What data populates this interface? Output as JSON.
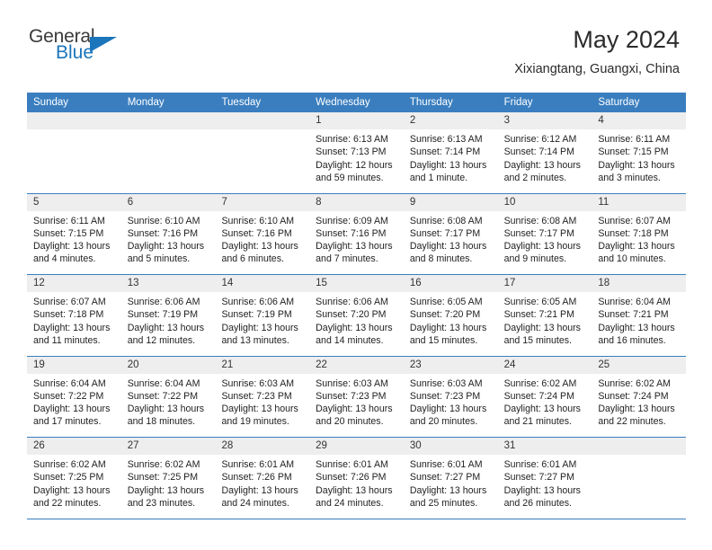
{
  "brand": {
    "name_top": "General",
    "name_bottom": "Blue",
    "accent_color": "#1b75bb"
  },
  "header": {
    "title": "May 2024",
    "subtitle": "Xixiangtang, Guangxi, China"
  },
  "calendar": {
    "header_bg": "#3a7ebf",
    "daynum_band_bg": "#eeeeee",
    "weekday_labels": [
      "Sunday",
      "Monday",
      "Tuesday",
      "Wednesday",
      "Thursday",
      "Friday",
      "Saturday"
    ],
    "weeks": [
      [
        {
          "empty": true,
          "day": ""
        },
        {
          "empty": true,
          "day": ""
        },
        {
          "empty": true,
          "day": ""
        },
        {
          "day": "1",
          "sunrise": "Sunrise: 6:13 AM",
          "sunset": "Sunset: 7:13 PM",
          "daylight1": "Daylight: 12 hours",
          "daylight2": "and 59 minutes."
        },
        {
          "day": "2",
          "sunrise": "Sunrise: 6:13 AM",
          "sunset": "Sunset: 7:14 PM",
          "daylight1": "Daylight: 13 hours",
          "daylight2": "and 1 minute."
        },
        {
          "day": "3",
          "sunrise": "Sunrise: 6:12 AM",
          "sunset": "Sunset: 7:14 PM",
          "daylight1": "Daylight: 13 hours",
          "daylight2": "and 2 minutes."
        },
        {
          "day": "4",
          "sunrise": "Sunrise: 6:11 AM",
          "sunset": "Sunset: 7:15 PM",
          "daylight1": "Daylight: 13 hours",
          "daylight2": "and 3 minutes."
        }
      ],
      [
        {
          "day": "5",
          "sunrise": "Sunrise: 6:11 AM",
          "sunset": "Sunset: 7:15 PM",
          "daylight1": "Daylight: 13 hours",
          "daylight2": "and 4 minutes."
        },
        {
          "day": "6",
          "sunrise": "Sunrise: 6:10 AM",
          "sunset": "Sunset: 7:16 PM",
          "daylight1": "Daylight: 13 hours",
          "daylight2": "and 5 minutes."
        },
        {
          "day": "7",
          "sunrise": "Sunrise: 6:10 AM",
          "sunset": "Sunset: 7:16 PM",
          "daylight1": "Daylight: 13 hours",
          "daylight2": "and 6 minutes."
        },
        {
          "day": "8",
          "sunrise": "Sunrise: 6:09 AM",
          "sunset": "Sunset: 7:16 PM",
          "daylight1": "Daylight: 13 hours",
          "daylight2": "and 7 minutes."
        },
        {
          "day": "9",
          "sunrise": "Sunrise: 6:08 AM",
          "sunset": "Sunset: 7:17 PM",
          "daylight1": "Daylight: 13 hours",
          "daylight2": "and 8 minutes."
        },
        {
          "day": "10",
          "sunrise": "Sunrise: 6:08 AM",
          "sunset": "Sunset: 7:17 PM",
          "daylight1": "Daylight: 13 hours",
          "daylight2": "and 9 minutes."
        },
        {
          "day": "11",
          "sunrise": "Sunrise: 6:07 AM",
          "sunset": "Sunset: 7:18 PM",
          "daylight1": "Daylight: 13 hours",
          "daylight2": "and 10 minutes."
        }
      ],
      [
        {
          "day": "12",
          "sunrise": "Sunrise: 6:07 AM",
          "sunset": "Sunset: 7:18 PM",
          "daylight1": "Daylight: 13 hours",
          "daylight2": "and 11 minutes."
        },
        {
          "day": "13",
          "sunrise": "Sunrise: 6:06 AM",
          "sunset": "Sunset: 7:19 PM",
          "daylight1": "Daylight: 13 hours",
          "daylight2": "and 12 minutes."
        },
        {
          "day": "14",
          "sunrise": "Sunrise: 6:06 AM",
          "sunset": "Sunset: 7:19 PM",
          "daylight1": "Daylight: 13 hours",
          "daylight2": "and 13 minutes."
        },
        {
          "day": "15",
          "sunrise": "Sunrise: 6:06 AM",
          "sunset": "Sunset: 7:20 PM",
          "daylight1": "Daylight: 13 hours",
          "daylight2": "and 14 minutes."
        },
        {
          "day": "16",
          "sunrise": "Sunrise: 6:05 AM",
          "sunset": "Sunset: 7:20 PM",
          "daylight1": "Daylight: 13 hours",
          "daylight2": "and 15 minutes."
        },
        {
          "day": "17",
          "sunrise": "Sunrise: 6:05 AM",
          "sunset": "Sunset: 7:21 PM",
          "daylight1": "Daylight: 13 hours",
          "daylight2": "and 15 minutes."
        },
        {
          "day": "18",
          "sunrise": "Sunrise: 6:04 AM",
          "sunset": "Sunset: 7:21 PM",
          "daylight1": "Daylight: 13 hours",
          "daylight2": "and 16 minutes."
        }
      ],
      [
        {
          "day": "19",
          "sunrise": "Sunrise: 6:04 AM",
          "sunset": "Sunset: 7:22 PM",
          "daylight1": "Daylight: 13 hours",
          "daylight2": "and 17 minutes."
        },
        {
          "day": "20",
          "sunrise": "Sunrise: 6:04 AM",
          "sunset": "Sunset: 7:22 PM",
          "daylight1": "Daylight: 13 hours",
          "daylight2": "and 18 minutes."
        },
        {
          "day": "21",
          "sunrise": "Sunrise: 6:03 AM",
          "sunset": "Sunset: 7:23 PM",
          "daylight1": "Daylight: 13 hours",
          "daylight2": "and 19 minutes."
        },
        {
          "day": "22",
          "sunrise": "Sunrise: 6:03 AM",
          "sunset": "Sunset: 7:23 PM",
          "daylight1": "Daylight: 13 hours",
          "daylight2": "and 20 minutes."
        },
        {
          "day": "23",
          "sunrise": "Sunrise: 6:03 AM",
          "sunset": "Sunset: 7:23 PM",
          "daylight1": "Daylight: 13 hours",
          "daylight2": "and 20 minutes."
        },
        {
          "day": "24",
          "sunrise": "Sunrise: 6:02 AM",
          "sunset": "Sunset: 7:24 PM",
          "daylight1": "Daylight: 13 hours",
          "daylight2": "and 21 minutes."
        },
        {
          "day": "25",
          "sunrise": "Sunrise: 6:02 AM",
          "sunset": "Sunset: 7:24 PM",
          "daylight1": "Daylight: 13 hours",
          "daylight2": "and 22 minutes."
        }
      ],
      [
        {
          "day": "26",
          "sunrise": "Sunrise: 6:02 AM",
          "sunset": "Sunset: 7:25 PM",
          "daylight1": "Daylight: 13 hours",
          "daylight2": "and 22 minutes."
        },
        {
          "day": "27",
          "sunrise": "Sunrise: 6:02 AM",
          "sunset": "Sunset: 7:25 PM",
          "daylight1": "Daylight: 13 hours",
          "daylight2": "and 23 minutes."
        },
        {
          "day": "28",
          "sunrise": "Sunrise: 6:01 AM",
          "sunset": "Sunset: 7:26 PM",
          "daylight1": "Daylight: 13 hours",
          "daylight2": "and 24 minutes."
        },
        {
          "day": "29",
          "sunrise": "Sunrise: 6:01 AM",
          "sunset": "Sunset: 7:26 PM",
          "daylight1": "Daylight: 13 hours",
          "daylight2": "and 24 minutes."
        },
        {
          "day": "30",
          "sunrise": "Sunrise: 6:01 AM",
          "sunset": "Sunset: 7:27 PM",
          "daylight1": "Daylight: 13 hours",
          "daylight2": "and 25 minutes."
        },
        {
          "day": "31",
          "sunrise": "Sunrise: 6:01 AM",
          "sunset": "Sunset: 7:27 PM",
          "daylight1": "Daylight: 13 hours",
          "daylight2": "and 26 minutes."
        },
        {
          "empty": true,
          "day": ""
        }
      ]
    ]
  }
}
